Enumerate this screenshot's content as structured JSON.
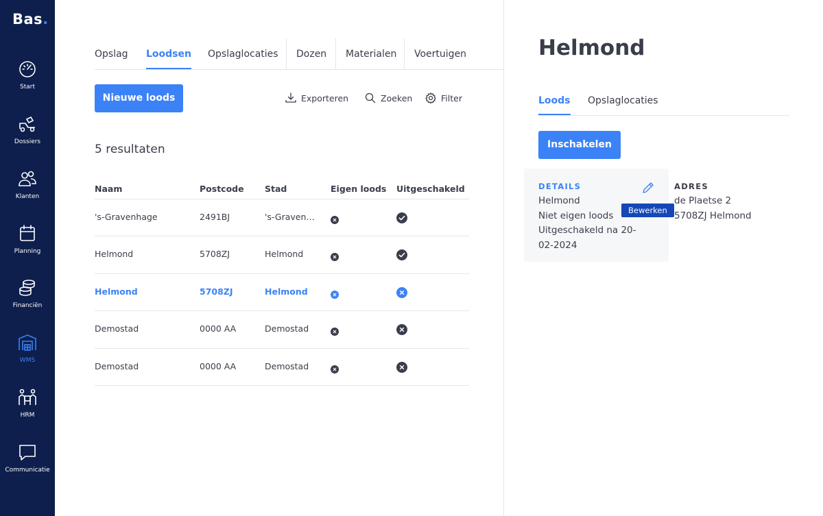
{
  "app": {
    "logo": "Bas",
    "logo_dot": "."
  },
  "sidebar": {
    "items": [
      {
        "label": "Start",
        "icon": "speedometer-icon"
      },
      {
        "label": "Dossiers",
        "icon": "truck-icon"
      },
      {
        "label": "Klanten",
        "icon": "users-icon"
      },
      {
        "label": "Planning",
        "icon": "calendar-icon"
      },
      {
        "label": "Financiën",
        "icon": "coins-icon"
      },
      {
        "label": "WMS",
        "icon": "warehouse-icon",
        "active": true
      },
      {
        "label": "HRM",
        "icon": "team-icon"
      },
      {
        "label": "Communicatie",
        "icon": "chat-icon"
      }
    ]
  },
  "tabs": [
    "Opslag",
    "Loodsen",
    "Opslaglocaties",
    "Dozen",
    "Materialen",
    "Voertuigen"
  ],
  "active_tab": "Loodsen",
  "toolbar": {
    "new_button": "Nieuwe loods",
    "export": "Exporteren",
    "search": "Zoeken",
    "filter": "Filter"
  },
  "results_label": "5 resultaten",
  "table": {
    "columns": [
      "Naam",
      "Postcode",
      "Stad",
      "Eigen loods",
      "Uitgeschakeld"
    ],
    "rows": [
      {
        "naam": "'s-Gravenhage",
        "postcode": "2491BJ",
        "stad": "'s-Gravenhage",
        "eigen": "no",
        "uit": "yes",
        "selected": false
      },
      {
        "naam": "Helmond",
        "postcode": "5708ZJ",
        "stad": "Helmond",
        "eigen": "no",
        "uit": "yes",
        "selected": false
      },
      {
        "naam": "Helmond",
        "postcode": "5708ZJ",
        "stad": "Helmond",
        "eigen": "no",
        "uit": "no",
        "selected": true
      },
      {
        "naam": "Demostad",
        "postcode": "0000 AA",
        "stad": "Demostad",
        "eigen": "no",
        "uit": "no",
        "selected": false
      },
      {
        "naam": "Demostad",
        "postcode": "0000 AA",
        "stad": "Demostad",
        "eigen": "no",
        "uit": "no",
        "selected": false
      }
    ]
  },
  "detail": {
    "title": "Helmond",
    "tabs": [
      "Loods",
      "Opslaglocaties"
    ],
    "active_tab": "Loods",
    "enable_button": "Inschakelen",
    "details_heading": "DETAILS",
    "details_lines": [
      "Helmond",
      "Niet eigen loods",
      "Uitgeschakeld na 20-",
      "02-2024"
    ],
    "edit_tooltip": "Bewerken",
    "adres_heading": "ADRES",
    "adres_lines": [
      "de Plaetse 2",
      "5708ZJ Helmond"
    ]
  },
  "colors": {
    "sidebar_bg": "#0e1f4d",
    "accent": "#3b82f6",
    "tooltip_bg": "#1447b8",
    "text": "#3a3d4a",
    "icon_dark": "#3a3d4a"
  }
}
